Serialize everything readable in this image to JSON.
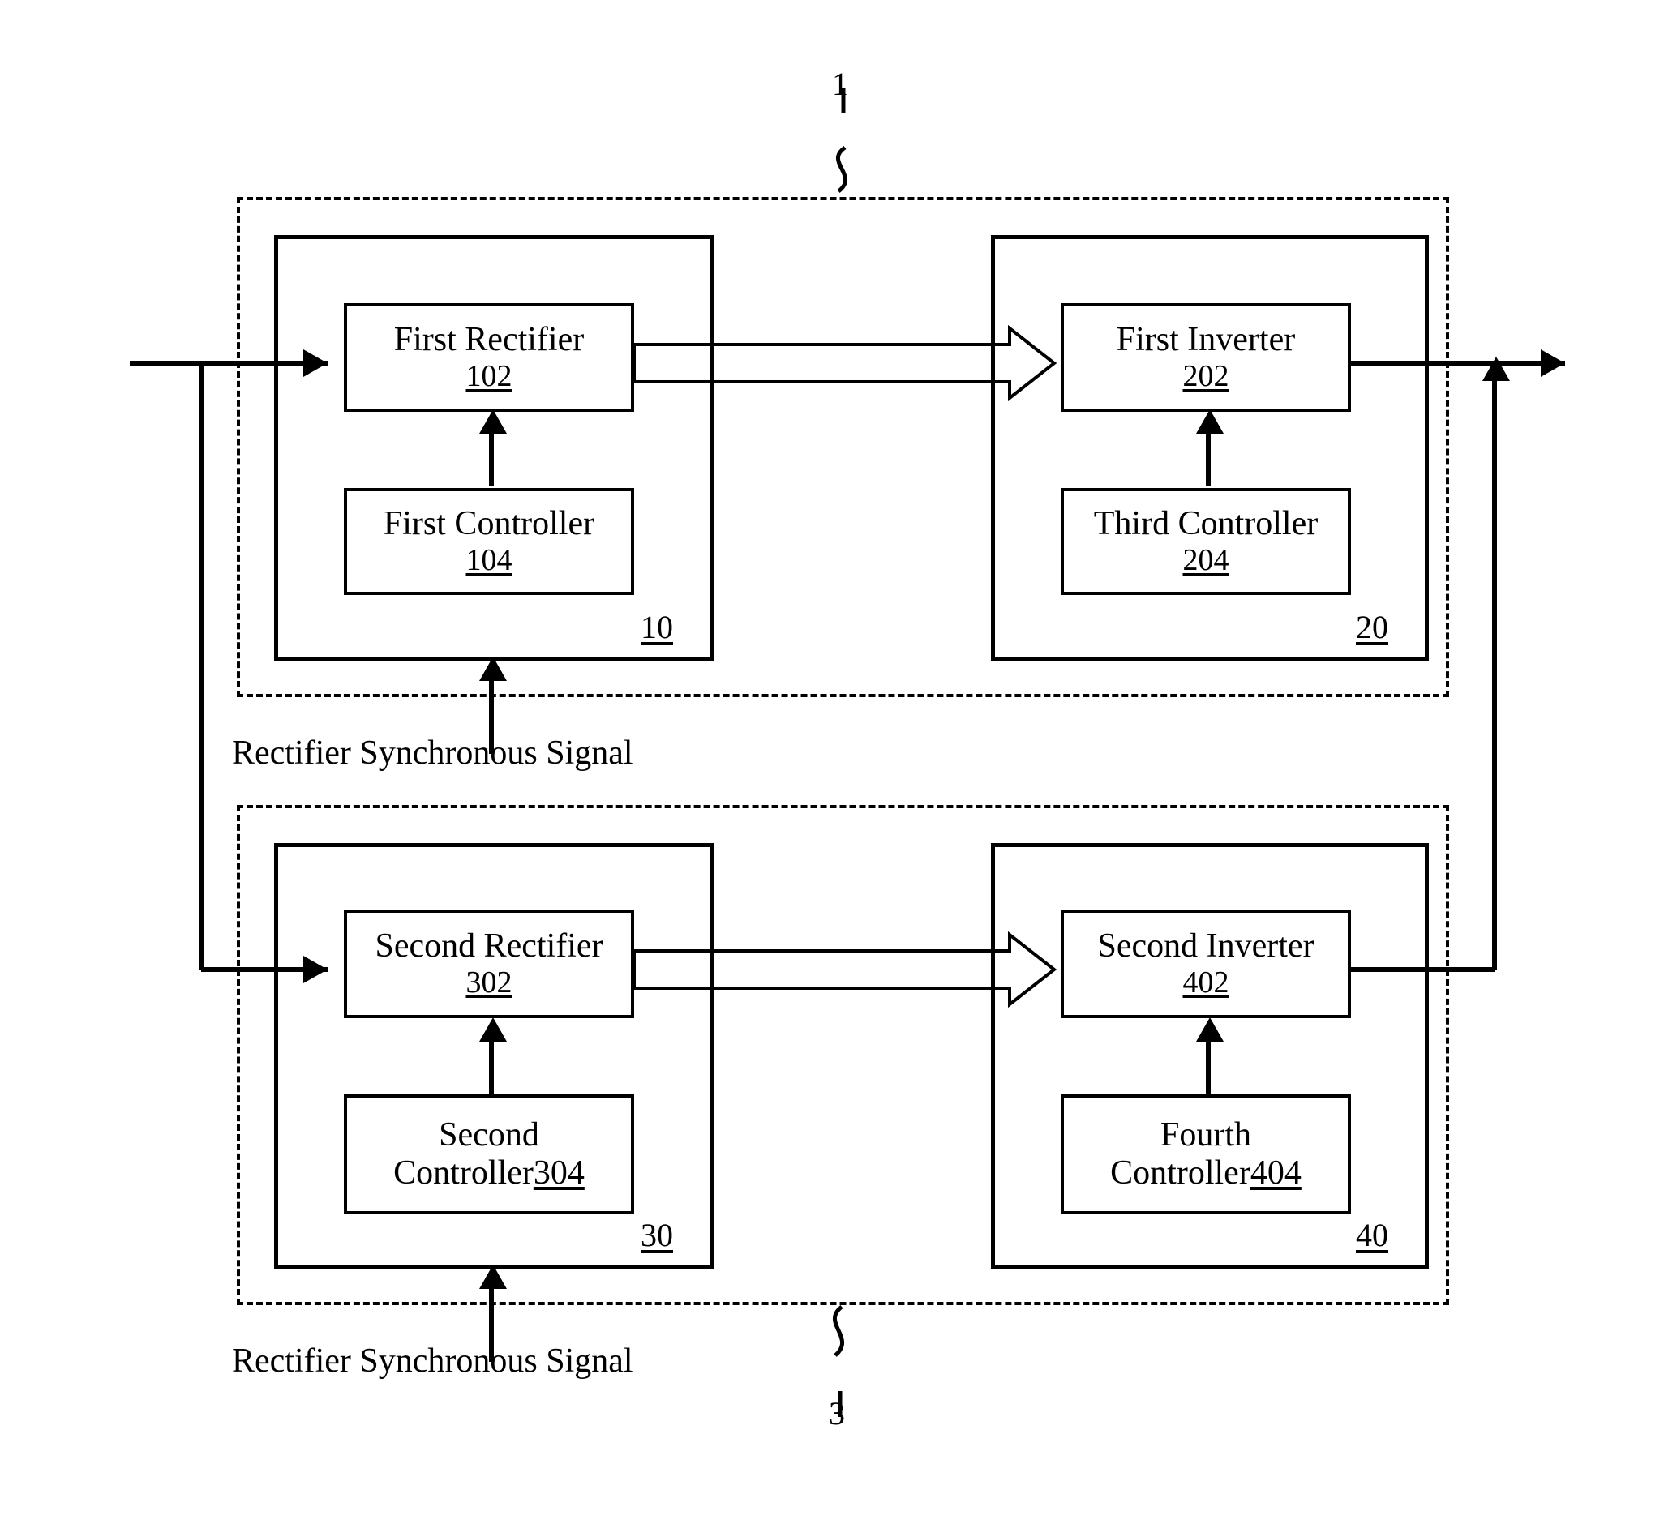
{
  "figure": {
    "top_ref": "1",
    "bottom_ref": "3"
  },
  "groups": {
    "rectifier_top": {
      "ref": "10"
    },
    "inverter_top": {
      "ref": "20"
    },
    "rectifier_bottom": {
      "ref": "30"
    },
    "inverter_bottom": {
      "ref": "40"
    }
  },
  "blocks": {
    "first_rectifier": {
      "title": "First Rectifier",
      "ref": "102"
    },
    "first_controller": {
      "title": "First Controller",
      "ref": "104"
    },
    "first_inverter": {
      "title": "First Inverter",
      "ref": "202"
    },
    "third_controller": {
      "title": "Third Controller",
      "ref": "204"
    },
    "second_rectifier": {
      "title": "Second Rectifier",
      "ref": "302"
    },
    "second_controller": {
      "line1": "Second",
      "line2_text": "Controller",
      "line2_ref": "304"
    },
    "second_inverter": {
      "title": "Second Inverter",
      "ref": "402"
    },
    "fourth_controller": {
      "line1": "Fourth",
      "line2_text": "Controller",
      "line2_ref": "404"
    }
  },
  "signals": {
    "top_sync": "Rectifier Synchronous Signal",
    "bottom_sync": "Rectifier Synchronous Signal"
  },
  "colors": {
    "stroke": "#000000",
    "background": "#ffffff"
  }
}
